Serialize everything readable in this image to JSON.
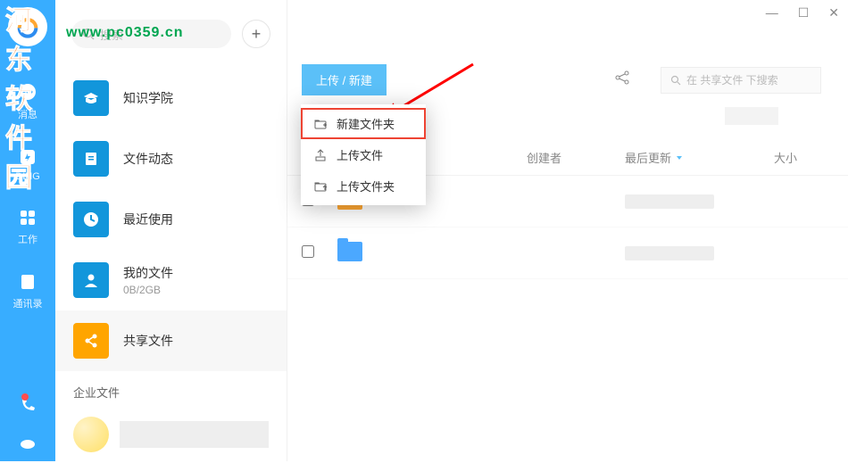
{
  "watermark": {
    "title": "河东软件园",
    "url": "www.pc0359.cn"
  },
  "rail": [
    {
      "label": "消息"
    },
    {
      "label": "DING"
    },
    {
      "label": "工作"
    },
    {
      "label": "通讯录"
    }
  ],
  "search": {
    "placeholder": "搜索"
  },
  "sidebar": {
    "items": [
      {
        "title": "知识学院"
      },
      {
        "title": "文件动态"
      },
      {
        "title": "最近使用"
      },
      {
        "title": "我的文件",
        "sub": "0B/2GB"
      },
      {
        "title": "共享文件"
      }
    ],
    "section": "企业文件"
  },
  "toolbar": {
    "upload": "上传 / 新建",
    "search_placeholder": "在 共享文件 下搜索"
  },
  "dropdown": [
    {
      "label": "新建文件夹"
    },
    {
      "label": "上传文件"
    },
    {
      "label": "上传文件夹"
    }
  ],
  "columns": {
    "creator": "创建者",
    "updated": "最后更新",
    "size": "大小"
  }
}
